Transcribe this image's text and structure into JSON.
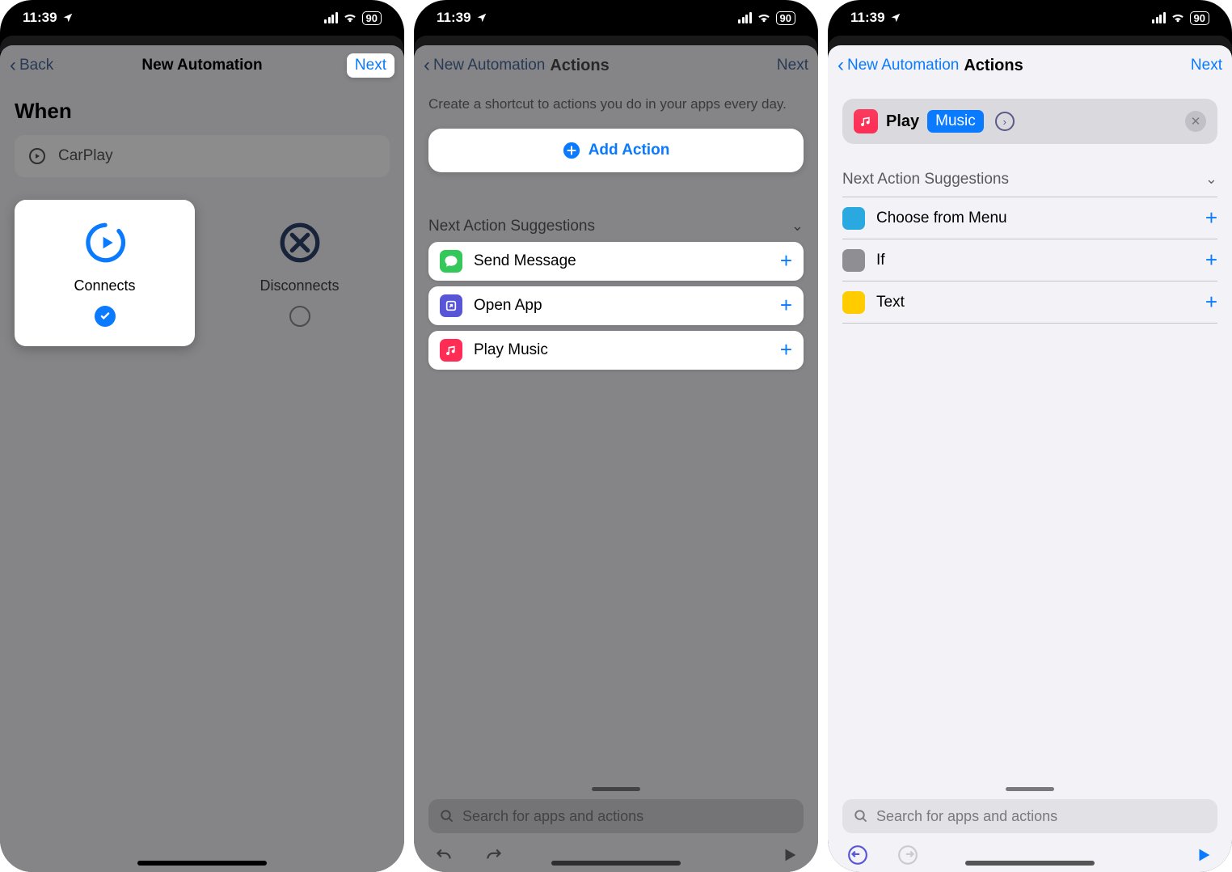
{
  "status": {
    "time": "11:39",
    "battery": "90"
  },
  "panel1": {
    "back": "Back",
    "title": "New Automation",
    "next": "Next",
    "when": "When",
    "trigger": "CarPlay",
    "connects": "Connects",
    "disconnects": "Disconnects"
  },
  "panel2": {
    "back": "New Automation",
    "title": "Actions",
    "next": "Next",
    "desc": "Create a shortcut to actions you do in your apps every day.",
    "add_action": "Add Action",
    "sugg_header": "Next Action Suggestions",
    "suggestions": [
      {
        "label": "Send Message",
        "icon": "messages",
        "color": "#34c759"
      },
      {
        "label": "Open App",
        "icon": "open-app",
        "color": "#5856d6"
      },
      {
        "label": "Play Music",
        "icon": "music",
        "color": "#ff2d55"
      }
    ],
    "search_placeholder": "Search for apps and actions"
  },
  "panel3": {
    "back": "New Automation",
    "title": "Actions",
    "next": "Next",
    "action_play": "Play",
    "action_token": "Music",
    "sugg_header": "Next Action Suggestions",
    "suggestions": [
      {
        "label": "Choose from Menu",
        "color": "#2aa9e0"
      },
      {
        "label": "If",
        "color": "#8e8e93"
      },
      {
        "label": "Text",
        "color": "#ffcc00"
      }
    ],
    "search_placeholder": "Search for apps and actions"
  }
}
